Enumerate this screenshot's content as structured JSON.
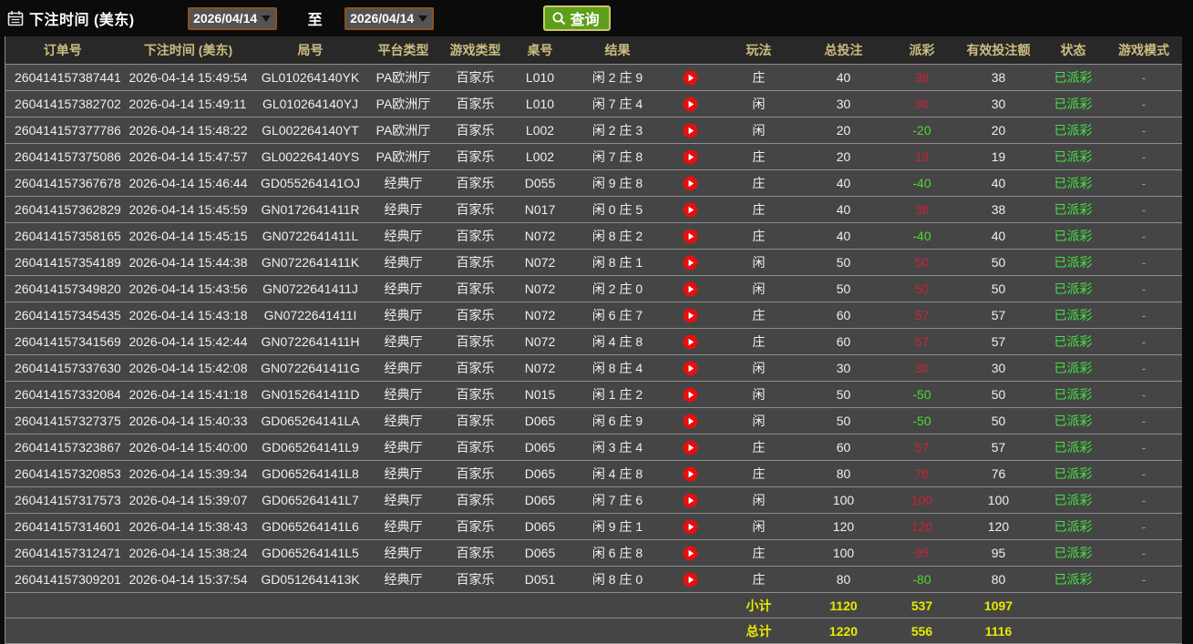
{
  "toolbar": {
    "label": "下注时间 (美东)",
    "date_from": "2026/04/14",
    "to_label": "至",
    "date_to": "2026/04/14",
    "search_label": "查询"
  },
  "colors": {
    "accent_green_button": "#5e9e1a",
    "win_red": "#cc2236",
    "loss_green": "#4cd930",
    "status_green": "#44e244",
    "total_yellow": "#e9e900",
    "header_gold": "#cdbd80",
    "date_button_border": "#8a531f"
  },
  "table": {
    "columns": [
      "订单号",
      "下注时间 (美东)",
      "局号",
      "平台类型",
      "游戏类型",
      "桌号",
      "结果",
      "",
      "玩法",
      "总投注",
      "派彩",
      "有效投注额",
      "状态",
      "游戏模式"
    ],
    "rows": [
      {
        "order": "260414157387441",
        "time": "2026-04-14 15:49:54",
        "round": "GL010264140YK",
        "platform": "PA欧洲厅",
        "game": "百家乐",
        "table_no": "L010",
        "result": "闲 2 庄 9",
        "play": "庄",
        "total_bet": "40",
        "payout": "38",
        "payout_class": "win",
        "valid": "38",
        "status": "已派彩",
        "mode": "-"
      },
      {
        "order": "260414157382702",
        "time": "2026-04-14 15:49:11",
        "round": "GL010264140YJ",
        "platform": "PA欧洲厅",
        "game": "百家乐",
        "table_no": "L010",
        "result": "闲 7 庄 4",
        "play": "闲",
        "total_bet": "30",
        "payout": "30",
        "payout_class": "win",
        "valid": "30",
        "status": "已派彩",
        "mode": "-"
      },
      {
        "order": "260414157377786",
        "time": "2026-04-14 15:48:22",
        "round": "GL002264140YT",
        "platform": "PA欧洲厅",
        "game": "百家乐",
        "table_no": "L002",
        "result": "闲 2 庄 3",
        "play": "闲",
        "total_bet": "20",
        "payout": "-20",
        "payout_class": "loss",
        "valid": "20",
        "status": "已派彩",
        "mode": "-"
      },
      {
        "order": "260414157375086",
        "time": "2026-04-14 15:47:57",
        "round": "GL002264140YS",
        "platform": "PA欧洲厅",
        "game": "百家乐",
        "table_no": "L002",
        "result": "闲 7 庄 8",
        "play": "庄",
        "total_bet": "20",
        "payout": "19",
        "payout_class": "win",
        "valid": "19",
        "status": "已派彩",
        "mode": "-"
      },
      {
        "order": "260414157367678",
        "time": "2026-04-14 15:46:44",
        "round": "GD055264141OJ",
        "platform": "经典厅",
        "game": "百家乐",
        "table_no": "D055",
        "result": "闲 9 庄 8",
        "play": "庄",
        "total_bet": "40",
        "payout": "-40",
        "payout_class": "loss",
        "valid": "40",
        "status": "已派彩",
        "mode": "-"
      },
      {
        "order": "260414157362829",
        "time": "2026-04-14 15:45:59",
        "round": "GN0172641411R",
        "platform": "经典厅",
        "game": "百家乐",
        "table_no": "N017",
        "result": "闲 0 庄 5",
        "play": "庄",
        "total_bet": "40",
        "payout": "38",
        "payout_class": "win",
        "valid": "38",
        "status": "已派彩",
        "mode": "-"
      },
      {
        "order": "260414157358165",
        "time": "2026-04-14 15:45:15",
        "round": "GN0722641411L",
        "platform": "经典厅",
        "game": "百家乐",
        "table_no": "N072",
        "result": "闲 8 庄 2",
        "play": "庄",
        "total_bet": "40",
        "payout": "-40",
        "payout_class": "loss",
        "valid": "40",
        "status": "已派彩",
        "mode": "-"
      },
      {
        "order": "260414157354189",
        "time": "2026-04-14 15:44:38",
        "round": "GN0722641411K",
        "platform": "经典厅",
        "game": "百家乐",
        "table_no": "N072",
        "result": "闲 8 庄 1",
        "play": "闲",
        "total_bet": "50",
        "payout": "50",
        "payout_class": "win",
        "valid": "50",
        "status": "已派彩",
        "mode": "-"
      },
      {
        "order": "260414157349820",
        "time": "2026-04-14 15:43:56",
        "round": "GN0722641411J",
        "platform": "经典厅",
        "game": "百家乐",
        "table_no": "N072",
        "result": "闲 2 庄 0",
        "play": "闲",
        "total_bet": "50",
        "payout": "50",
        "payout_class": "win",
        "valid": "50",
        "status": "已派彩",
        "mode": "-"
      },
      {
        "order": "260414157345435",
        "time": "2026-04-14 15:43:18",
        "round": "GN0722641411I",
        "platform": "经典厅",
        "game": "百家乐",
        "table_no": "N072",
        "result": "闲 6 庄 7",
        "play": "庄",
        "total_bet": "60",
        "payout": "57",
        "payout_class": "win",
        "valid": "57",
        "status": "已派彩",
        "mode": "-"
      },
      {
        "order": "260414157341569",
        "time": "2026-04-14 15:42:44",
        "round": "GN0722641411H",
        "platform": "经典厅",
        "game": "百家乐",
        "table_no": "N072",
        "result": "闲 4 庄 8",
        "play": "庄",
        "total_bet": "60",
        "payout": "57",
        "payout_class": "win",
        "valid": "57",
        "status": "已派彩",
        "mode": "-"
      },
      {
        "order": "260414157337630",
        "time": "2026-04-14 15:42:08",
        "round": "GN0722641411G",
        "platform": "经典厅",
        "game": "百家乐",
        "table_no": "N072",
        "result": "闲 8 庄 4",
        "play": "闲",
        "total_bet": "30",
        "payout": "30",
        "payout_class": "win",
        "valid": "30",
        "status": "已派彩",
        "mode": "-"
      },
      {
        "order": "260414157332084",
        "time": "2026-04-14 15:41:18",
        "round": "GN0152641411D",
        "platform": "经典厅",
        "game": "百家乐",
        "table_no": "N015",
        "result": "闲 1 庄 2",
        "play": "闲",
        "total_bet": "50",
        "payout": "-50",
        "payout_class": "loss",
        "valid": "50",
        "status": "已派彩",
        "mode": "-"
      },
      {
        "order": "260414157327375",
        "time": "2026-04-14 15:40:33",
        "round": "GD065264141LA",
        "platform": "经典厅",
        "game": "百家乐",
        "table_no": "D065",
        "result": "闲 6 庄 9",
        "play": "闲",
        "total_bet": "50",
        "payout": "-50",
        "payout_class": "loss",
        "valid": "50",
        "status": "已派彩",
        "mode": "-"
      },
      {
        "order": "260414157323867",
        "time": "2026-04-14 15:40:00",
        "round": "GD065264141L9",
        "platform": "经典厅",
        "game": "百家乐",
        "table_no": "D065",
        "result": "闲 3 庄 4",
        "play": "庄",
        "total_bet": "60",
        "payout": "57",
        "payout_class": "win",
        "valid": "57",
        "status": "已派彩",
        "mode": "-"
      },
      {
        "order": "260414157320853",
        "time": "2026-04-14 15:39:34",
        "round": "GD065264141L8",
        "platform": "经典厅",
        "game": "百家乐",
        "table_no": "D065",
        "result": "闲 4 庄 8",
        "play": "庄",
        "total_bet": "80",
        "payout": "76",
        "payout_class": "win",
        "valid": "76",
        "status": "已派彩",
        "mode": "-"
      },
      {
        "order": "260414157317573",
        "time": "2026-04-14 15:39:07",
        "round": "GD065264141L7",
        "platform": "经典厅",
        "game": "百家乐",
        "table_no": "D065",
        "result": "闲 7 庄 6",
        "play": "闲",
        "total_bet": "100",
        "payout": "100",
        "payout_class": "win",
        "valid": "100",
        "status": "已派彩",
        "mode": "-"
      },
      {
        "order": "260414157314601",
        "time": "2026-04-14 15:38:43",
        "round": "GD065264141L6",
        "platform": "经典厅",
        "game": "百家乐",
        "table_no": "D065",
        "result": "闲 9 庄 1",
        "play": "闲",
        "total_bet": "120",
        "payout": "120",
        "payout_class": "win",
        "valid": "120",
        "status": "已派彩",
        "mode": "-"
      },
      {
        "order": "260414157312471",
        "time": "2026-04-14 15:38:24",
        "round": "GD065264141L5",
        "platform": "经典厅",
        "game": "百家乐",
        "table_no": "D065",
        "result": "闲 6 庄 8",
        "play": "庄",
        "total_bet": "100",
        "payout": "95",
        "payout_class": "win",
        "valid": "95",
        "status": "已派彩",
        "mode": "-"
      },
      {
        "order": "260414157309201",
        "time": "2026-04-14 15:37:54",
        "round": "GD0512641413K",
        "platform": "经典厅",
        "game": "百家乐",
        "table_no": "D051",
        "result": "闲 8 庄 0",
        "play": "庄",
        "total_bet": "80",
        "payout": "-80",
        "payout_class": "loss",
        "valid": "80",
        "status": "已派彩",
        "mode": "-"
      }
    ],
    "subtotal": {
      "label": "小计",
      "total_bet": "1120",
      "payout": "537",
      "valid": "1097"
    },
    "total": {
      "label": "总计",
      "total_bet": "1220",
      "payout": "556",
      "valid": "1116"
    }
  }
}
